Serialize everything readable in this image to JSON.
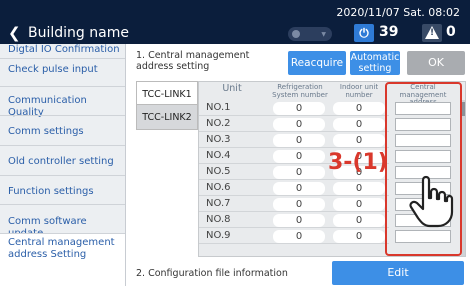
{
  "header": {
    "title": "Building name",
    "datetime": "2020/11/07 Sat. 08:02",
    "power_count": "39",
    "warning_count": "0"
  },
  "sidebar": {
    "items": [
      {
        "label": "Digtal IO Confirmation"
      },
      {
        "label": "Check pulse input"
      },
      {
        "label": "Communication Quality"
      },
      {
        "label": "Comm settings"
      },
      {
        "label": "Old controller setting"
      },
      {
        "label": "Function settings"
      },
      {
        "label": "Comm software update"
      },
      {
        "label": "Central management address Setting"
      }
    ]
  },
  "section1": {
    "title": "1. Central management address setting",
    "reacquire": "Reacquire",
    "automatic": "Automatic setting",
    "ok": "OK"
  },
  "tabs": [
    "TCC-LINK1",
    "TCC-LINK2"
  ],
  "table": {
    "headers": {
      "unit": "Unit",
      "refrigeration": "Refrigeration System number",
      "indoor": "Indoor unit number",
      "central": "Central management address"
    },
    "rows": [
      {
        "unit": "NO.1",
        "ref": "0",
        "indoor": "0"
      },
      {
        "unit": "NO.2",
        "ref": "0",
        "indoor": "0"
      },
      {
        "unit": "NO.3",
        "ref": "0",
        "indoor": "0"
      },
      {
        "unit": "NO.4",
        "ref": "0",
        "indoor": "0"
      },
      {
        "unit": "NO.5",
        "ref": "0",
        "indoor": "0"
      },
      {
        "unit": "NO.6",
        "ref": "0",
        "indoor": "0"
      },
      {
        "unit": "NO.7",
        "ref": "0",
        "indoor": "0"
      },
      {
        "unit": "NO.8",
        "ref": "0",
        "indoor": "0"
      },
      {
        "unit": "NO.9",
        "ref": "0",
        "indoor": "0"
      }
    ]
  },
  "annotation": "3-(1)",
  "section2": {
    "title": "2. Configuration file information",
    "edit": "Edit"
  },
  "colors": {
    "header_bg": "#0b1e3c",
    "accent_blue": "#3d8fe6",
    "highlight_red": "#d9382c"
  }
}
